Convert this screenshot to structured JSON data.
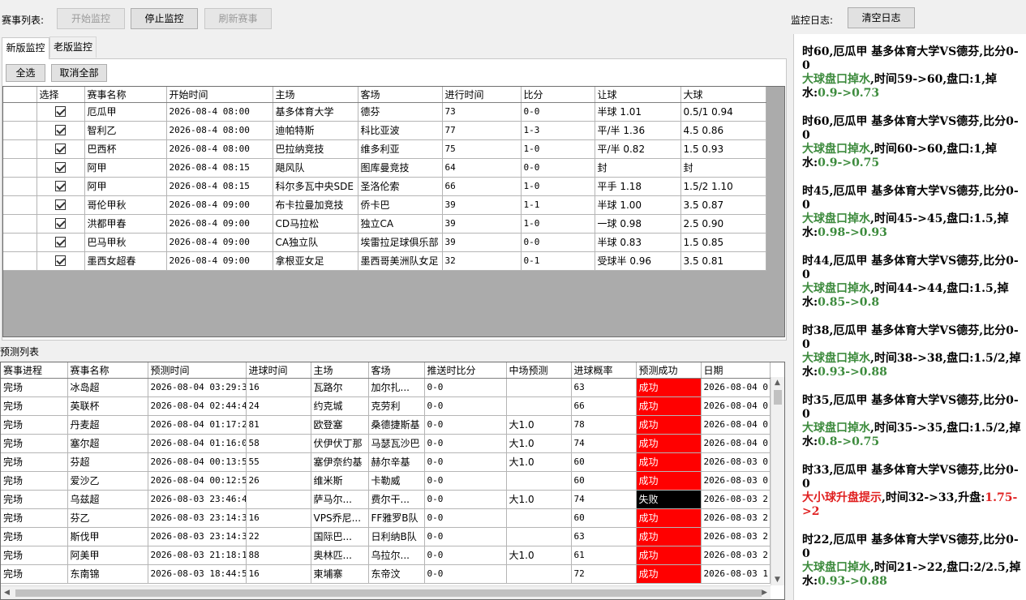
{
  "top": {
    "match_list_label": "赛事列表:",
    "start_monitor": "开始监控",
    "stop_monitor": "停止监控",
    "refresh_matches": "刷新赛事",
    "monitor_log_label": "监控日志:",
    "clear_log": "清空日志"
  },
  "tabs": [
    "新版监控",
    "老版监控"
  ],
  "select_all": "全选",
  "deselect_all": "取消全部",
  "match_table": {
    "headers": [
      "选择",
      "赛事名称",
      "开始时间",
      "主场",
      "客场",
      "进行时间",
      "比分",
      "让球",
      "大球"
    ],
    "rows": [
      [
        "厄瓜甲",
        "2026-08-4 08:00",
        "基多体育大学",
        "德芬",
        "73",
        "0-0",
        "半球 1.01",
        "0.5/1 0.94"
      ],
      [
        "智利乙",
        "2026-08-4 08:00",
        "迪帕特斯",
        "科比亚波",
        "77",
        "1-3",
        "平/半 1.36",
        "4.5 0.86"
      ],
      [
        "巴西杯",
        "2026-08-4 08:00",
        "巴拉纳竞技",
        "维多利亚",
        "75",
        "1-0",
        "平/半 0.82",
        "1.5 0.93"
      ],
      [
        "阿甲",
        "2026-08-4 08:15",
        "飓风队",
        "图库曼竞技",
        "64",
        "0-0",
        "封",
        "封"
      ],
      [
        "阿甲",
        "2026-08-4 08:15",
        "科尔多瓦中央SDE",
        "圣洛伦索",
        "66",
        "1-0",
        "平手 1.18",
        "1.5/2 1.10"
      ],
      [
        "哥伦甲秋",
        "2026-08-4 09:00",
        "布卡拉曼加竞技",
        "侨卡巴",
        "39",
        "1-1",
        "半球 1.00",
        "3.5 0.87"
      ],
      [
        "洪都甲春",
        "2026-08-4 09:00",
        "CD马拉松",
        "独立CA",
        "39",
        "1-0",
        "一球 0.98",
        "2.5 0.90"
      ],
      [
        "巴马甲秋",
        "2026-08-4 09:00",
        "CA独立队",
        "埃雷拉足球俱乐部",
        "39",
        "0-0",
        "半球 0.83",
        "1.5 0.85"
      ],
      [
        "墨西女超春",
        "2026-08-4 09:00",
        "拿根亚女足",
        "墨西哥美洲队女足",
        "32",
        "0-1",
        "受球半 0.96",
        "3.5 0.81"
      ]
    ]
  },
  "prediction_label": "预测列表",
  "prediction_table": {
    "headers": [
      "赛事进程",
      "赛事名称",
      "预测时间",
      "进球时间",
      "主场",
      "客场",
      "推送时比分",
      "中场预测",
      "进球概率",
      "预测成功",
      "日期"
    ],
    "rows": [
      [
        "完场",
        "冰岛超",
        "2026-08-04 03:29:32",
        "16",
        "瓦路尔",
        "加尔扎...",
        "0-0",
        "",
        "63",
        "成功",
        "2026-08-04 0..."
      ],
      [
        "完场",
        "英联杯",
        "2026-08-04 02:44:44",
        "24",
        "约克城",
        "克劳利",
        "0-0",
        "",
        "66",
        "成功",
        "2026-08-04 0..."
      ],
      [
        "完场",
        "丹麦超",
        "2026-08-04 01:17:21",
        "81",
        "欧登塞",
        "桑德捷斯基",
        "0-0",
        "大1.0",
        "78",
        "成功",
        "2026-08-04 0..."
      ],
      [
        "完场",
        "塞尔超",
        "2026-08-04 01:16:00",
        "58",
        "伏伊伏丁那",
        "马瑟瓦沙巴",
        "0-0",
        "大1.0",
        "74",
        "成功",
        "2026-08-04 0..."
      ],
      [
        "完场",
        "芬超",
        "2026-08-04 00:13:50",
        "55",
        "塞伊奈约基",
        "赫尔辛基",
        "0-0",
        "大1.0",
        "60",
        "成功",
        "2026-08-03 0..."
      ],
      [
        "完场",
        "爱沙乙",
        "2026-08-04 00:12:59",
        "26",
        "维米斯",
        "卡勒威",
        "0-0",
        "",
        "60",
        "成功",
        "2026-08-03 0..."
      ],
      [
        "完场",
        "乌兹超",
        "2026-08-03 23:46:45",
        "",
        "萨马尔...",
        "费尔干...",
        "0-0",
        "大1.0",
        "74",
        "失败",
        "2026-08-03 2..."
      ],
      [
        "完场",
        "芬乙",
        "2026-08-03 23:14:31",
        "16",
        "VPS乔尼...",
        "FF雅罗B队",
        "0-0",
        "",
        "60",
        "成功",
        "2026-08-03 2..."
      ],
      [
        "完场",
        "斯伐甲",
        "2026-08-03 23:14:31",
        "22",
        "国际巴...",
        "日利纳B队",
        "0-0",
        "",
        "63",
        "成功",
        "2026-08-03 2..."
      ],
      [
        "完场",
        "阿美甲",
        "2026-08-03 21:18:18",
        "88",
        "奥林匹...",
        "乌拉尔...",
        "0-0",
        "大1.0",
        "61",
        "成功",
        "2026-08-03 2..."
      ],
      [
        "完场",
        "东南锦",
        "2026-08-03 18:44:55",
        "16",
        "柬埔寨",
        "东帝汶",
        "0-0",
        "",
        "72",
        "成功",
        "2026-08-03 1..."
      ]
    ]
  },
  "log_entries": [
    {
      "head": "时60,厄瓜甲  基多体育大学VS德芬,比分0-0",
      "type": "大球盘口掉水",
      "detail": ",时间59->60,盘口:1,掉水:",
      "value": "0.9->0.73"
    },
    {
      "head": "时60,厄瓜甲  基多体育大学VS德芬,比分0-0",
      "type": "大球盘口掉水",
      "detail": ",时间60->60,盘口:1,掉水:",
      "value": "0.9->0.75"
    },
    {
      "head": "时45,厄瓜甲  基多体育大学VS德芬,比分0-0",
      "type": "大球盘口掉水",
      "detail": ",时间45->45,盘口:1.5,掉水:",
      "value": "0.98->0.93"
    },
    {
      "head": "时44,厄瓜甲  基多体育大学VS德芬,比分0-0",
      "type": "大球盘口掉水",
      "detail": ",时间44->44,盘口:1.5,掉水:",
      "value": "0.85->0.8"
    },
    {
      "head": "时38,厄瓜甲  基多体育大学VS德芬,比分0-0",
      "type": "大球盘口掉水",
      "detail": ",时间38->38,盘口:1.5/2,掉水:",
      "value": "0.93->0.88"
    },
    {
      "head": "时35,厄瓜甲  基多体育大学VS德芬,比分0-0",
      "type": "大球盘口掉水",
      "detail": ",时间35->35,盘口:1.5/2,掉水:",
      "value": "0.8->0.75"
    },
    {
      "head": "时33,厄瓜甲  基多体育大学VS德芬,比分0-0",
      "type": "大小球升盘提示",
      "detail": ",时间32->33,升盘:",
      "value": "1.75->2",
      "alert": true
    },
    {
      "head": "时22,厄瓜甲  基多体育大学VS德芬,比分0-0",
      "type": "大球盘口掉水",
      "detail": ",时间21->22,盘口:2/2.5,掉水:",
      "value": "0.93->0.88"
    }
  ],
  "colors": {
    "success": "#ff0000",
    "fail": "#000000",
    "log_green": "#3d8b3d",
    "log_red": "#e02020"
  }
}
